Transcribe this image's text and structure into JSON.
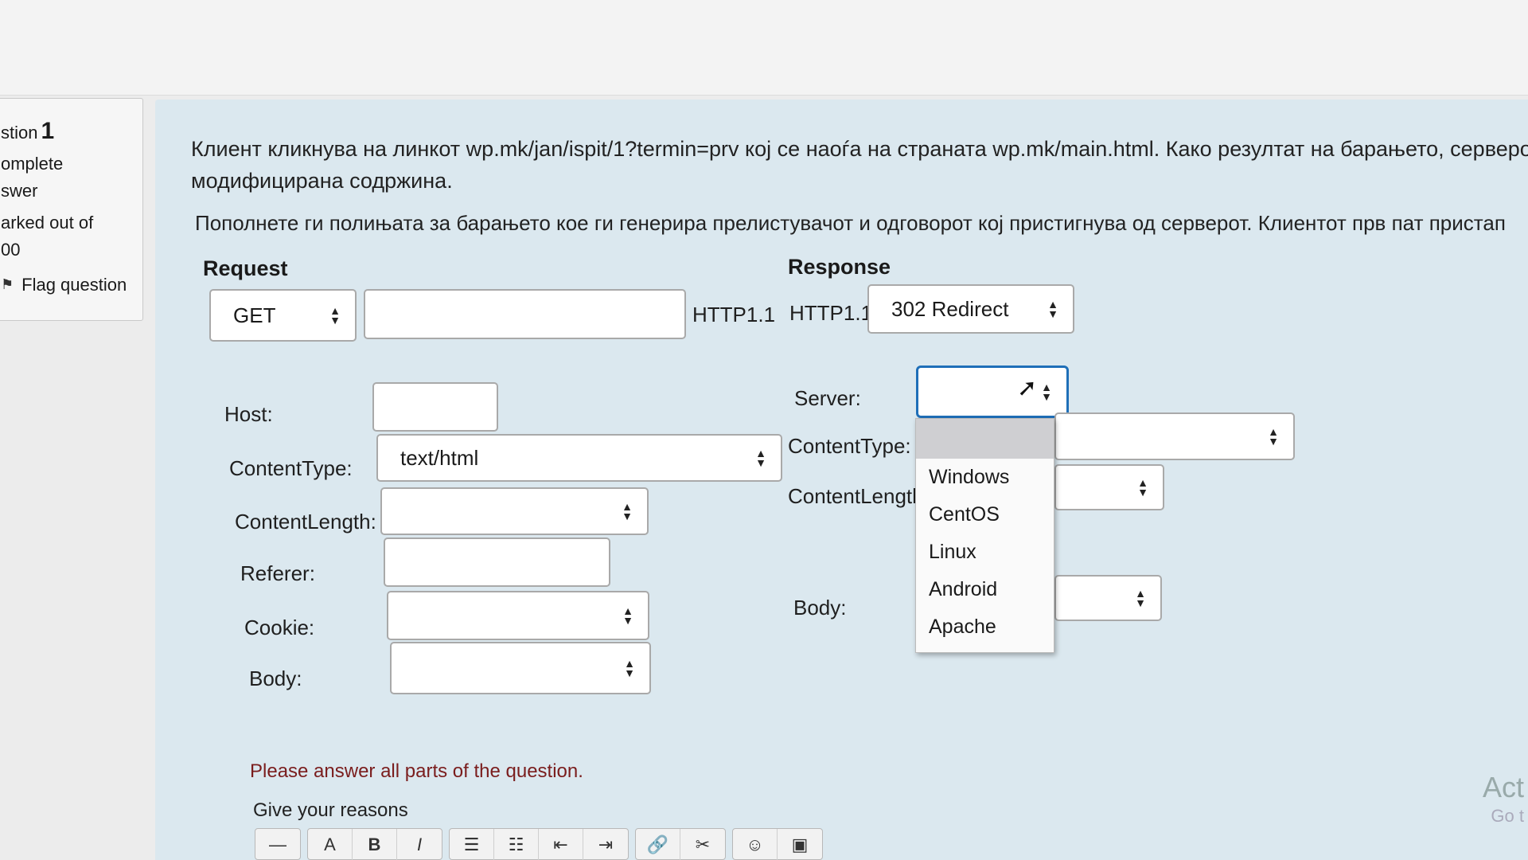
{
  "question_info": {
    "question_prefix": "stion",
    "question_number": "1",
    "status": "omplete",
    "answer": "swer",
    "marked": "arked out of",
    "marks": "00",
    "flag_label": "Flag question"
  },
  "question": {
    "line1": "Клиент кликнува на линкот  wp.mk/jan/ispit/1?termin=prv кој се наоѓа на страната wp.mk/main.html. Како резултат на барањето, серверот ј",
    "line2": "модифицирана содржина.",
    "instruction": "Пополнете ги полињата за барањето кое ги генерира прелистувачот и одговорот кој пристигнува од серверот. Клиентот прв пат пристап"
  },
  "request": {
    "heading": "Request",
    "method": "GET",
    "url_value": "",
    "protocol": "HTTP1.1",
    "host_label": "Host:",
    "host_value": "",
    "content_type_label": "ContentType:",
    "content_type_value": "text/html",
    "content_length_label": "ContentLength:",
    "content_length_value": "",
    "referer_label": "Referer:",
    "referer_value": "",
    "cookie_label": "Cookie:",
    "cookie_value": "",
    "body_label": "Body:",
    "body_value": ""
  },
  "response": {
    "heading": "Response",
    "protocol": "HTTP1.1",
    "status": "302 Redirect",
    "server_label": "Server:",
    "server_value": "",
    "content_type_label": "ContentType:",
    "content_length_label": "ContentLength",
    "body_label": "Body:",
    "server_options": [
      "",
      "Windows",
      "CentOS",
      "Linux",
      "Android",
      "Apache"
    ]
  },
  "footer": {
    "message": "Please answer all parts of the question.",
    "reasons_label": "Give your reasons"
  },
  "toolbar": {
    "bold": "B",
    "italic": "I"
  },
  "watermark": {
    "line1": "Act",
    "line2": "Go t"
  },
  "colors": {
    "panel_bg": "#dbe8ef",
    "focus_border": "#1f6fb8",
    "message": "#7a1d1d"
  }
}
